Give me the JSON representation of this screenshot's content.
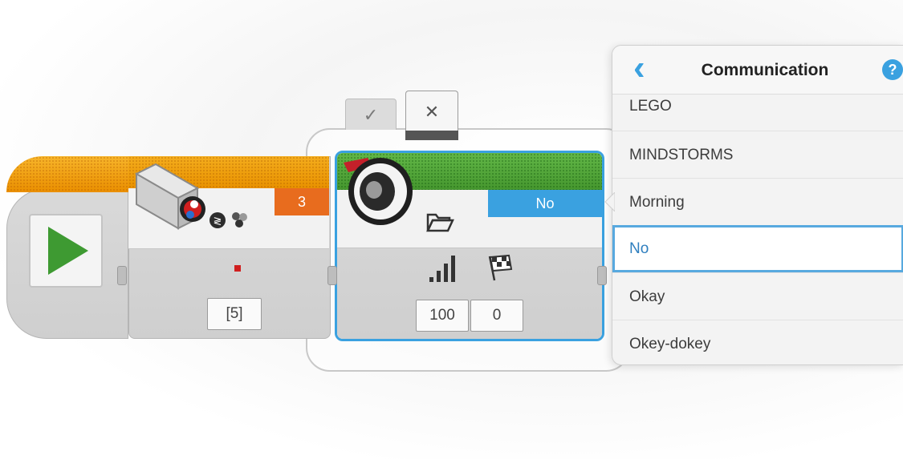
{
  "start_block": {
    "play_icon": "play-triangle-icon"
  },
  "sensor_block": {
    "sensor_icon": "color-sensor-icon",
    "mode_icon": "compare-color-icon",
    "port": "3",
    "param_value": "[5]"
  },
  "sound_block": {
    "icon": "speaker-icon",
    "mode_icon": "folder-icon",
    "file_value": "No",
    "volume_icon": "volume-bars-icon",
    "volume": "100",
    "play_type_icon": "checkered-flag-icon",
    "play_type": "0"
  },
  "switch": {
    "check_label": "✓",
    "close_label": "✕"
  },
  "panel": {
    "title": "Communication",
    "back_label": "‹",
    "help_label": "?",
    "items": [
      {
        "label": "LEGO"
      },
      {
        "label": "MINDSTORMS"
      },
      {
        "label": "Morning"
      },
      {
        "label": "No"
      },
      {
        "label": "Okay"
      },
      {
        "label": "Okey-dokey"
      }
    ],
    "selected_index": 3
  },
  "colors": {
    "start_orange": "#f2a007",
    "sound_green": "#55a83c",
    "port_orange": "#e86c1e",
    "accent_blue": "#3aa1e0"
  }
}
